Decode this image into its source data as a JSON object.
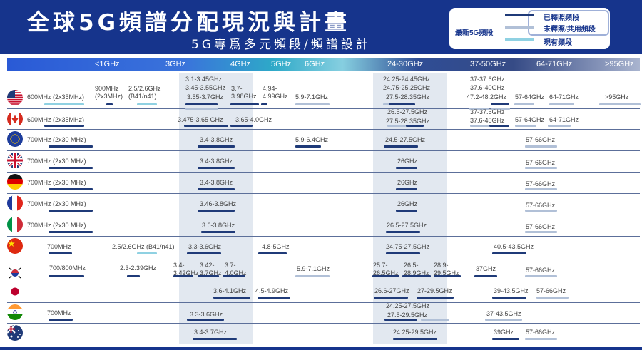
{
  "header": {
    "title": "全球5G頻譜分配現況與計畫",
    "subtitle": "5G專爲多元頻段/頻譜設計",
    "legend_title": "最新5G頻段",
    "legend": [
      {
        "label": "已釋照頻段",
        "color": "#1f3a78"
      },
      {
        "label": "未釋照/共用頻段",
        "color": "#b1c0d7"
      },
      {
        "label": "現有頻段",
        "color": "#8fd1e2"
      }
    ]
  },
  "colors": {
    "header_bg": "#16348c",
    "released": "#1f3a78",
    "unreleased": "#b1c0d7",
    "existing": "#8fd1e2"
  },
  "chart_data": {
    "type": "table",
    "band_axis": [
      "<1GHz",
      "3GHz",
      "4GHz",
      "5GHz",
      "6GHz",
      "24-30GHz",
      "37-50GHz",
      "64-71GHz",
      ">95GHz"
    ],
    "countries": [
      {
        "flag": "usa",
        "allocations": [
          {
            "label": "600MHz (2x35MHz)",
            "status": "existing"
          },
          {
            "label": "900MHz (2x3MHz)",
            "status": "released"
          },
          {
            "label": "2.5/2.6GHz (B41/n41)",
            "status": "existing"
          },
          {
            "label": "3.1-3.45GHz",
            "status": "released"
          },
          {
            "label": "3.45-3.55GHz",
            "status": "unreleased"
          },
          {
            "label": "3.55-3.7GHz",
            "status": "unreleased"
          },
          {
            "label": "3.7-3.98GHz",
            "status": "released"
          },
          {
            "label": "4.94-4.99GHz",
            "status": "released"
          },
          {
            "label": "5.9-7.1GHz",
            "status": "unreleased"
          },
          {
            "label": "24.25-24.45GHz",
            "status": "unreleased"
          },
          {
            "label": "24.75-25.25GHz",
            "status": "unreleased"
          },
          {
            "label": "27.5-28.35GHz",
            "status": "released"
          },
          {
            "label": "37-37.6GHz",
            "status": "unreleased"
          },
          {
            "label": "37.6-40GHz",
            "status": "unreleased"
          },
          {
            "label": "47.2-48.2GHz",
            "status": "released"
          },
          {
            "label": "57-64GHz",
            "status": "unreleased"
          },
          {
            "label": "64-71GHz",
            "status": "unreleased"
          },
          {
            "label": ">95GHz",
            "status": "unreleased"
          }
        ]
      },
      {
        "flag": "canada",
        "allocations": [
          {
            "label": "600MHz (2x35MHz)",
            "status": "released"
          },
          {
            "label": "3.475-3.65 GHz",
            "status": "released"
          },
          {
            "label": "3.65-4.0GHz",
            "status": "released"
          },
          {
            "label": "26.5-27.5GHz",
            "status": "unreleased"
          },
          {
            "label": "27.5-28.35GHz",
            "status": "released"
          },
          {
            "label": "37-37.6GHz",
            "status": "unreleased"
          },
          {
            "label": "37.6-40GHz",
            "status": "released"
          },
          {
            "label": "57-64GHz",
            "status": "unreleased"
          },
          {
            "label": "64-71GHz",
            "status": "unreleased"
          }
        ]
      },
      {
        "flag": "eu",
        "allocations": [
          {
            "label": "700MHz (2x30 MHz)",
            "status": "released"
          },
          {
            "label": "3.4-3.8GHz",
            "status": "released"
          },
          {
            "label": "5.9-6.4GHz",
            "status": "released"
          },
          {
            "label": "24.5-27.5GHz",
            "status": "released"
          },
          {
            "label": "57-66GHz",
            "status": "unreleased"
          }
        ]
      },
      {
        "flag": "uk",
        "allocations": [
          {
            "label": "700MHz (2x30 MHz)",
            "status": "released"
          },
          {
            "label": "3.4-3.8GHz",
            "status": "released"
          },
          {
            "label": "26GHz",
            "status": "released"
          },
          {
            "label": "57-66GHz",
            "status": "unreleased"
          }
        ]
      },
      {
        "flag": "germany",
        "allocations": [
          {
            "label": "700MHz (2x30 MHz)",
            "status": "released"
          },
          {
            "label": "3.4-3.8GHz",
            "status": "released"
          },
          {
            "label": "26GHz",
            "status": "released"
          },
          {
            "label": "57-66GHz",
            "status": "unreleased"
          }
        ]
      },
      {
        "flag": "france",
        "allocations": [
          {
            "label": "700MHz (2x30 MHz)",
            "status": "released"
          },
          {
            "label": "3.46-3.8GHz",
            "status": "released"
          },
          {
            "label": "26GHz",
            "status": "released"
          },
          {
            "label": "57-66GHz",
            "status": "unreleased"
          }
        ]
      },
      {
        "flag": "italy",
        "allocations": [
          {
            "label": "700MHz (2x30 MHz)",
            "status": "released"
          },
          {
            "label": "3.6-3.8GHz",
            "status": "released"
          },
          {
            "label": "26.5-27.5GHz",
            "status": "released"
          },
          {
            "label": "57-66GHz",
            "status": "unreleased"
          }
        ]
      },
      {
        "flag": "china",
        "allocations": [
          {
            "label": "700MHz",
            "status": "released"
          },
          {
            "label": "2.5/2.6GHz (B41/n41)",
            "status": "existing"
          },
          {
            "label": "3.3-3.6GHz",
            "status": "released"
          },
          {
            "label": "4.8-5GHz",
            "status": "released"
          },
          {
            "label": "24.75-27.5GHz",
            "status": "released"
          },
          {
            "label": "40.5-43.5GHz",
            "status": "released"
          }
        ]
      },
      {
        "flag": "korea",
        "allocations": [
          {
            "label": "700/800MHz",
            "status": "released"
          },
          {
            "label": "2.3-2.39GHz",
            "status": "released"
          },
          {
            "label": "3.4-3.42GHz",
            "status": "released"
          },
          {
            "label": "3.42-3.7GHz",
            "status": "released"
          },
          {
            "label": "3.7-4.0GHz",
            "status": "released"
          },
          {
            "label": "5.9-7.1GHz",
            "status": "unreleased"
          },
          {
            "label": "25.7-26.5GHz",
            "status": "released"
          },
          {
            "label": "26.5-28.9GHz",
            "status": "released"
          },
          {
            "label": "28.9-29.5GHz",
            "status": "released"
          },
          {
            "label": "37GHz",
            "status": "released"
          },
          {
            "label": "57-66GHz",
            "status": "unreleased"
          }
        ]
      },
      {
        "flag": "japan",
        "allocations": [
          {
            "label": "3.6-4.1GHz",
            "status": "released"
          },
          {
            "label": "4.5-4.9GHz",
            "status": "released"
          },
          {
            "label": "26.6-27GHz",
            "status": "released"
          },
          {
            "label": "27-29.5GHz",
            "status": "released"
          },
          {
            "label": "39-43.5GHz",
            "status": "released"
          },
          {
            "label": "57-66GHz",
            "status": "unreleased"
          }
        ]
      },
      {
        "flag": "india",
        "allocations": [
          {
            "label": "700MHz",
            "status": "released"
          },
          {
            "label": "3.3-3.6GHz",
            "status": "released"
          },
          {
            "label": "24.25-27.5GHz",
            "status": "released"
          },
          {
            "label": "27.5-29.5GHz",
            "status": "unreleased"
          },
          {
            "label": "37-43.5GHz",
            "status": "unreleased"
          }
        ]
      },
      {
        "flag": "australia",
        "allocations": [
          {
            "label": "3.4-3.7GHz",
            "status": "released"
          },
          {
            "label": "24.25-29.5GHz",
            "status": "released"
          },
          {
            "label": "39GHz",
            "status": "released"
          },
          {
            "label": "57-66GHz",
            "status": "unreleased"
          }
        ]
      }
    ]
  }
}
